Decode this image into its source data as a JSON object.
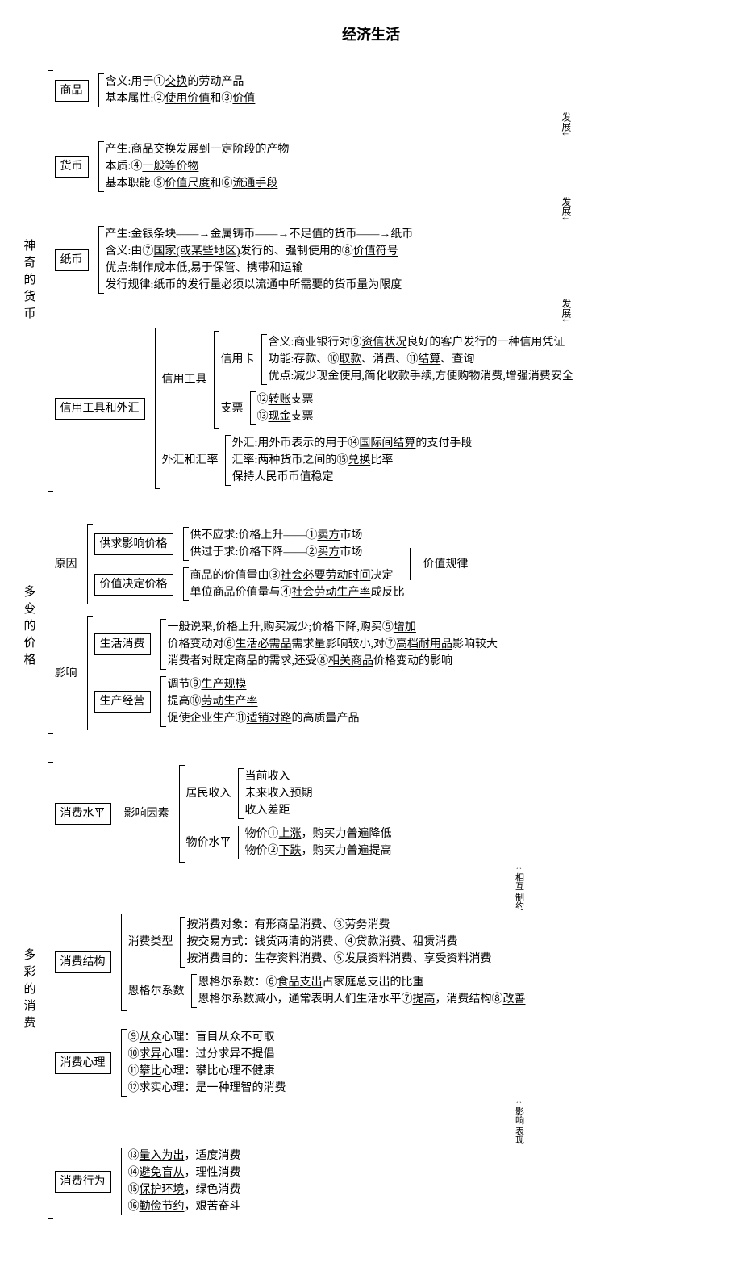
{
  "title": "经济生活",
  "s1": {
    "root": "神奇的货币",
    "n1_box": "商品",
    "n1_l1": "含义:用于①交换的劳动产品",
    "n1_l2": "基本属性:②使用价值和③价值",
    "d1": "发展↓",
    "n2_box": "货币",
    "n2_l1": "产生:商品交换发展到一定阶段的产物",
    "n2_l2": "本质:④一般等价物",
    "n2_l3": "基本职能:⑤价值尺度和⑥流通手段",
    "d2": "发展↓",
    "n3_box": "纸币",
    "n3_l1": "产生:金银条块——→金属铸币——→不足值的货币——→纸币",
    "n3_l2": "含义:由⑦国家(或某些地区)发行的、强制使用的⑧价值符号",
    "n3_l3": "优点:制作成本低,易于保管、携带和运输",
    "n3_l4": "发行规律:纸币的发行量必须以流通中所需要的货币量为限度",
    "d3": "发展↓",
    "n4_box": "信用工具和外汇",
    "n4a": "信用工具",
    "n4a1": "信用卡",
    "n4a1_l1": "含义:商业银行对⑨资信状况良好的客户发行的一种信用凭证",
    "n4a1_l2": "功能:存款、⑩取款、消费、⑪结算、查询",
    "n4a1_l3": "优点:减少现金使用,简化收款手续,方便购物消费,增强消费安全",
    "n4a2": "支票",
    "n4a2_l1": "⑫转账支票",
    "n4a2_l2": "⑬现金支票",
    "n4b": "外汇和汇率",
    "n4b_l1": "外汇:用外币表示的用于⑭国际间结算的支付手段",
    "n4b_l2": "汇率:两种货币之间的⑮兑换比率",
    "n4b_l3": "保持人民币币值稳定"
  },
  "s2": {
    "root": "多变的价格",
    "a": "原因",
    "a1_box": "供求影响价格",
    "a1_l1": "供不应求:价格上升——①卖方市场",
    "a1_l2": "供过于求:价格下降——②买方市场",
    "a2_box": "价值决定价格",
    "a2_l1": "商品的价值量由③社会必要劳动时间决定",
    "a2_l2": "单位商品价值量与④社会劳动生产率成反比",
    "right": "价值规律",
    "b": "影响",
    "b1_box": "生活消费",
    "b1_l1": "一般说来,价格上升,购买减少;价格下降,购买⑤增加",
    "b1_l2": "价格变动对⑥生活必需品需求量影响较小,对⑦高档耐用品影响较大",
    "b1_l3": "消费者对既定商品的需求,还受⑧相关商品价格变动的影响",
    "b2_box": "生产经营",
    "b2_l1": "调节⑨生产规模",
    "b2_l2": "提高⑩劳动生产率",
    "b2_l3": "促使企业生产⑪适销对路的高质量产品"
  },
  "s3": {
    "root": "多彩的消费",
    "n1_box": "消费水平",
    "n1_a": "影响因素",
    "n1_a1": "居民收入",
    "n1_a1_l1": "当前收入",
    "n1_a1_l2": "未来收入预期",
    "n1_a1_l3": "收入差距",
    "n1_a2": "物价水平",
    "n1_a2_l1": "物价①上涨，购买力普遍降低",
    "n1_a2_l2": "物价②下跌，购买力普遍提高",
    "c12": "相互 制约",
    "n2_box": "消费结构",
    "n2_a": "消费类型",
    "n2_a_l1": "按消费对象：有形商品消费、③劳务消费",
    "n2_a_l2": "按交易方式：钱货两清的消费、④贷款消费、租赁消费",
    "n2_a_l3": "按消费目的：生存资料消费、⑤发展资料消费、享受资料消费",
    "n2_b": "恩格尔系数",
    "n2_b_l1": "恩格尔系数：⑥食品支出占家庭总支出的比重",
    "n2_b_l2": "恩格尔系数减小，通常表明人们生活水平⑦提高，消费结构⑧改善",
    "n3_box": "消费心理",
    "n3_l1": "⑨从众心理：盲目从众不可取",
    "n3_l2": "⑩求异心理：过分求异不提倡",
    "n3_l3": "⑪攀比心理：攀比心理不健康",
    "n3_l4": "⑫求实心理：是一种理智的消费",
    "c34": "影响 表现",
    "n4_box": "消费行为",
    "n4_l1": "⑬量入为出，适度消费",
    "n4_l2": "⑭避免盲从，理性消费",
    "n4_l3": "⑮保护环境，绿色消费",
    "n4_l4": "⑯勤俭节约，艰苦奋斗"
  }
}
